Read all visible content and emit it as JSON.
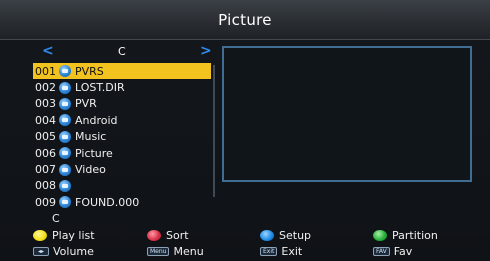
{
  "header": {
    "title": "Picture"
  },
  "drive": {
    "name": "C",
    "left_arrow": "<",
    "right_arrow": ">"
  },
  "files": [
    {
      "num": "001",
      "name": "PVRS",
      "selected": true
    },
    {
      "num": "002",
      "name": "LOST.DIR",
      "selected": false
    },
    {
      "num": "003",
      "name": "PVR",
      "selected": false
    },
    {
      "num": "004",
      "name": "Android",
      "selected": false
    },
    {
      "num": "005",
      "name": "Music",
      "selected": false
    },
    {
      "num": "006",
      "name": "Picture",
      "selected": false
    },
    {
      "num": "007",
      "name": "Video",
      "selected": false
    },
    {
      "num": "008",
      "name": "",
      "selected": false
    },
    {
      "num": "009",
      "name": "FOUND.000",
      "selected": false
    }
  ],
  "current_path": "C",
  "help": {
    "yellow": {
      "label": "Play list",
      "color": "#f5e11a"
    },
    "red": {
      "label": "Sort",
      "color": "#d9334a"
    },
    "blue": {
      "label": "Setup",
      "color": "#1f8ee8"
    },
    "green": {
      "label": "Partition",
      "color": "#28b23c"
    },
    "volume": {
      "key": "◂▸",
      "label": "Volume"
    },
    "menu": {
      "key": "Menu",
      "label": "Menu"
    },
    "exit": {
      "key": "Exit",
      "label": "Exit"
    },
    "fav": {
      "key": "FAV",
      "label": "Fav"
    }
  },
  "colors": {
    "selection": "#f2c21e",
    "accent": "#2f8cf0",
    "preview_border": "#3f6d93"
  }
}
